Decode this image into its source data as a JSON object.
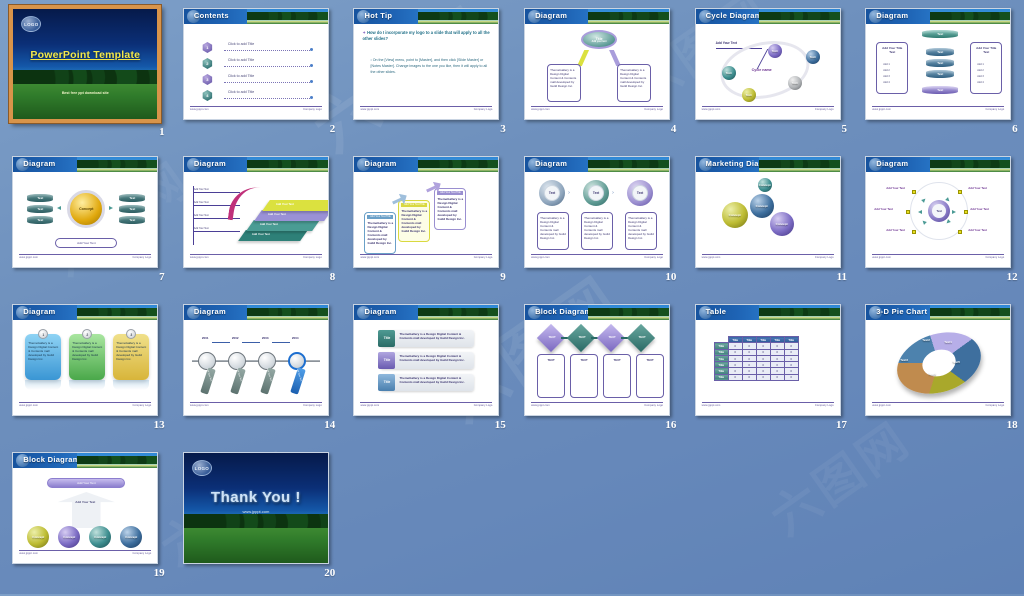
{
  "app": {
    "view": "PowerPoint template slide sorter / preview grid",
    "background_color": "#6b8dbb",
    "selection_border_color": "#d8944a",
    "watermark_text": "六图网"
  },
  "footer": {
    "left": "www.jpppt.com",
    "right": "Company Logo"
  },
  "slides": [
    {
      "number": "1",
      "type": "title",
      "logo": "LOGO",
      "title": "PowerPoint Template",
      "subtitle": "Best free ppt download site",
      "selected": true
    },
    {
      "number": "2",
      "type": "contents",
      "title": "Contents",
      "items": [
        {
          "index": "1",
          "label": "Click to add Title"
        },
        {
          "index": "2",
          "label": "Click to add Title"
        },
        {
          "index": "3",
          "label": "Click to add Title"
        },
        {
          "index": "4",
          "label": "Click to add Title"
        }
      ]
    },
    {
      "number": "3",
      "type": "hot-tip",
      "title": "Hot Tip",
      "question": "How do I incorporate my logo to a slide that will apply to all the other slides?",
      "answer": "On the [View] menu, point to [Master], and then click [Slide Master] or [Notes Master]. Change images to the one you like, then it will apply to all the other slides."
    },
    {
      "number": "4",
      "type": "diagram-two-branch",
      "title": "Diagram",
      "hub": {
        "label": "Title",
        "sub": "Add your text"
      },
      "boxes": [
        "ThemeGallery is a Design Digital Content & Contents mall developed by Guild Design Inc.",
        "ThemeGallery is a Design Digital Content & Contents mall developed by Guild Design Inc."
      ]
    },
    {
      "number": "5",
      "type": "cycle-diagram",
      "title": "Cycle Diagram",
      "callout": "Add Your Text",
      "center_label": "Cycle name",
      "nodes": [
        "Text",
        "Text",
        "Text",
        "Text",
        "Text"
      ]
    },
    {
      "number": "6",
      "type": "diagram-stack",
      "title": "Diagram",
      "top": "Text",
      "bottom": "Text",
      "middle": [
        "Text",
        "Text",
        "Text"
      ],
      "side_boxes": [
        {
          "heading": "Add Your Title Text",
          "lines": [
            "Add 1",
            "Add 2",
            "Add 3",
            "Add 4"
          ]
        },
        {
          "heading": "Add Your Title Text",
          "lines": [
            "Add 1",
            "Add 2",
            "Add 3",
            "Add 4"
          ]
        }
      ]
    },
    {
      "number": "7",
      "type": "diagram-concept",
      "title": "Diagram",
      "center": "Concept",
      "left": [
        "Text",
        "Text",
        "Text"
      ],
      "right": [
        "Text",
        "Text",
        "Text"
      ],
      "bottom": "Add Your Text"
    },
    {
      "number": "8",
      "type": "diagram-steps-up",
      "title": "Diagram",
      "axis_labels": [
        "Add Your Text",
        "Add Your Text",
        "Add Your Text",
        "Add Your Text"
      ],
      "steps": [
        "Add Your Text",
        "Add Your Text",
        "Add Your Text",
        "Add Your Text"
      ]
    },
    {
      "number": "9",
      "type": "diagram-three-card-flow",
      "title": "Diagram",
      "cards": [
        {
          "cap": "Add Your Text Title",
          "body": "ThemeGallery is a Design Digital Content & Contents mall developed by Guild Design Inc."
        },
        {
          "cap": "Add Your Text Title",
          "body": "ThemeGallery is a Design Digital Content & Contents mall developed by Guild Design Inc."
        },
        {
          "cap": "Add Your Text Title",
          "body": "ThemeGallery is a Design Digital Content & Contents mall developed by Guild Design Inc."
        }
      ]
    },
    {
      "number": "10",
      "type": "diagram-three-ring",
      "title": "Diagram",
      "rings": [
        "Text",
        "Text",
        "Text"
      ],
      "bodies": [
        "ThemeGallery is a Design Digital Content & Contents mall developed by Guild Design Inc.",
        "ThemeGallery is a Design Digital Content & Contents mall developed by Guild Design Inc.",
        "ThemeGallery is a Design Digital Content & Contents mall developed by Guild Design Inc."
      ]
    },
    {
      "number": "11",
      "type": "marketing-diagram",
      "title": "Marketing Diagram",
      "bubbles": [
        "Concept",
        "Concept",
        "Concept",
        "Concept"
      ]
    },
    {
      "number": "12",
      "type": "radial-diagram",
      "title": "Diagram",
      "center": "Text",
      "spokes": [
        "Add Your Text",
        "Add Your Text",
        "Add Your Text",
        "Add Your Text",
        "Add Your Text",
        "Add Your Text"
      ]
    },
    {
      "number": "13",
      "type": "diagram-three-panel",
      "title": "Diagram",
      "panels": [
        {
          "badge": "1",
          "body": "ThemeGallery is a Design Digital Content & Contents mall developed by Guild Design Inc."
        },
        {
          "badge": "2",
          "body": "ThemeGallery is a Design Digital Content & Contents mall developed by Guild Design Inc."
        },
        {
          "badge": "3",
          "body": "ThemeGallery is a Design Digital Content & Contents mall developed by Guild Design Inc."
        }
      ]
    },
    {
      "number": "14",
      "type": "timeline-diagram",
      "title": "Diagram",
      "years": [
        "2001",
        "2002",
        "2003",
        "2004"
      ],
      "tags": [
        "Add Your Text",
        "Add Your Text",
        "Add Your Text",
        "Add Your Text"
      ]
    },
    {
      "number": "15",
      "type": "diagram-title-rows",
      "title": "Diagram",
      "rows": [
        {
          "tag": "Title",
          "body": "ThemeGallery is a Design Digital Content & Contents mall developed by Guild Design Inc."
        },
        {
          "tag": "Title",
          "body": "ThemeGallery is a Design Digital Content & Contents mall developed by Guild Design Inc."
        },
        {
          "tag": "Title",
          "body": "ThemeGallery is a Design Digital Content & Contents mall developed by Guild Design Inc."
        }
      ]
    },
    {
      "number": "16",
      "type": "block-diagram",
      "title": "Block Diagram",
      "diamonds": [
        "TEXT",
        "TEXT",
        "TEXT",
        "TEXT"
      ],
      "columns": [
        "TEXT",
        "TEXT",
        "TEXT",
        "TEXT"
      ]
    },
    {
      "number": "17",
      "type": "table",
      "title": "Table",
      "column_headers": [
        "Title",
        "Title",
        "Title",
        "Title",
        "Title"
      ],
      "row_headers": [
        "Title",
        "Title",
        "Title",
        "Title",
        "Title",
        "Title"
      ],
      "cells": [
        [
          "0",
          "0",
          "0",
          "0",
          "0"
        ],
        [
          "0",
          "0",
          "0",
          "0",
          "0"
        ],
        [
          "0",
          "0",
          "0",
          "0",
          "0"
        ],
        [
          "0",
          "0",
          "0",
          "0",
          "0"
        ],
        [
          "0",
          "0",
          "0",
          "0",
          "0"
        ],
        [
          "0",
          "0",
          "0",
          "0",
          "0"
        ]
      ]
    },
    {
      "number": "18",
      "type": "pie-chart",
      "title": "3-D Pie Chart",
      "slices": [
        "Text1",
        "Text2",
        "Text3",
        "Text4",
        "Text5"
      ]
    },
    {
      "number": "19",
      "type": "block-diagram-pyramid",
      "title": "Block Diagram",
      "banner": "Add Your Text",
      "arrow_label": "Add Your Text",
      "spheres": [
        "Concept",
        "Concept",
        "Concept",
        "Concept"
      ]
    },
    {
      "number": "20",
      "type": "thank-you",
      "logo": "LOGO",
      "title": "Thank You !",
      "subtitle": "www.jpppt.com"
    }
  ],
  "chart_data": {
    "type": "pie",
    "title": "3-D Pie Chart",
    "labels": [
      "Text1",
      "Text2",
      "Text3",
      "Text4",
      "Text5"
    ],
    "values": [
      20,
      20,
      20,
      20,
      20
    ],
    "colors": [
      "#b7aee8",
      "#3e6f9e",
      "#a9a82b",
      "#c08b4e",
      "#4d82ad"
    ],
    "legend": "none",
    "donut": true
  }
}
